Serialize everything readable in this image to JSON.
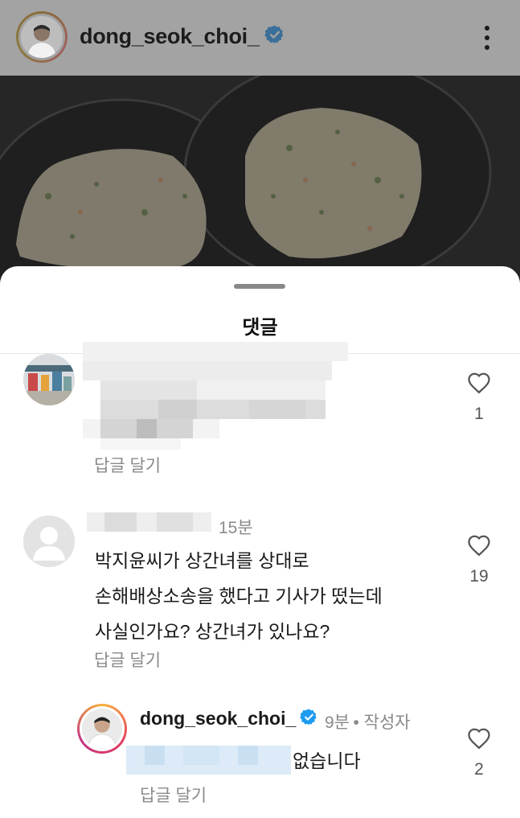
{
  "post": {
    "username": "dong_seok_choi_",
    "avatar_icon": "profile-photo",
    "verified_icon": "verified-badge-icon",
    "more_icon": "more-vertical-icon"
  },
  "sheet": {
    "title": "댓글"
  },
  "comments": [
    {
      "username": "",
      "text": "",
      "reply_label": "답글 달기",
      "likes": "1"
    },
    {
      "username": "",
      "time": "15분",
      "text_lines": [
        "박지윤씨가 상간녀를 상대로",
        "손해배상소송을 했다고 기사가 떴는데",
        "사실인가요? 상간녀가 있나요?"
      ],
      "reply_label": "답글 달기",
      "likes": "19"
    }
  ],
  "reply": {
    "username": "dong_seok_choi_",
    "time": "9분",
    "author_tag": "작성자",
    "text": "없습니다",
    "reply_label": "답글 달기",
    "likes": "2"
  },
  "colors": {
    "verified": "#1d9bf0",
    "muted": "#8a8a8a"
  }
}
